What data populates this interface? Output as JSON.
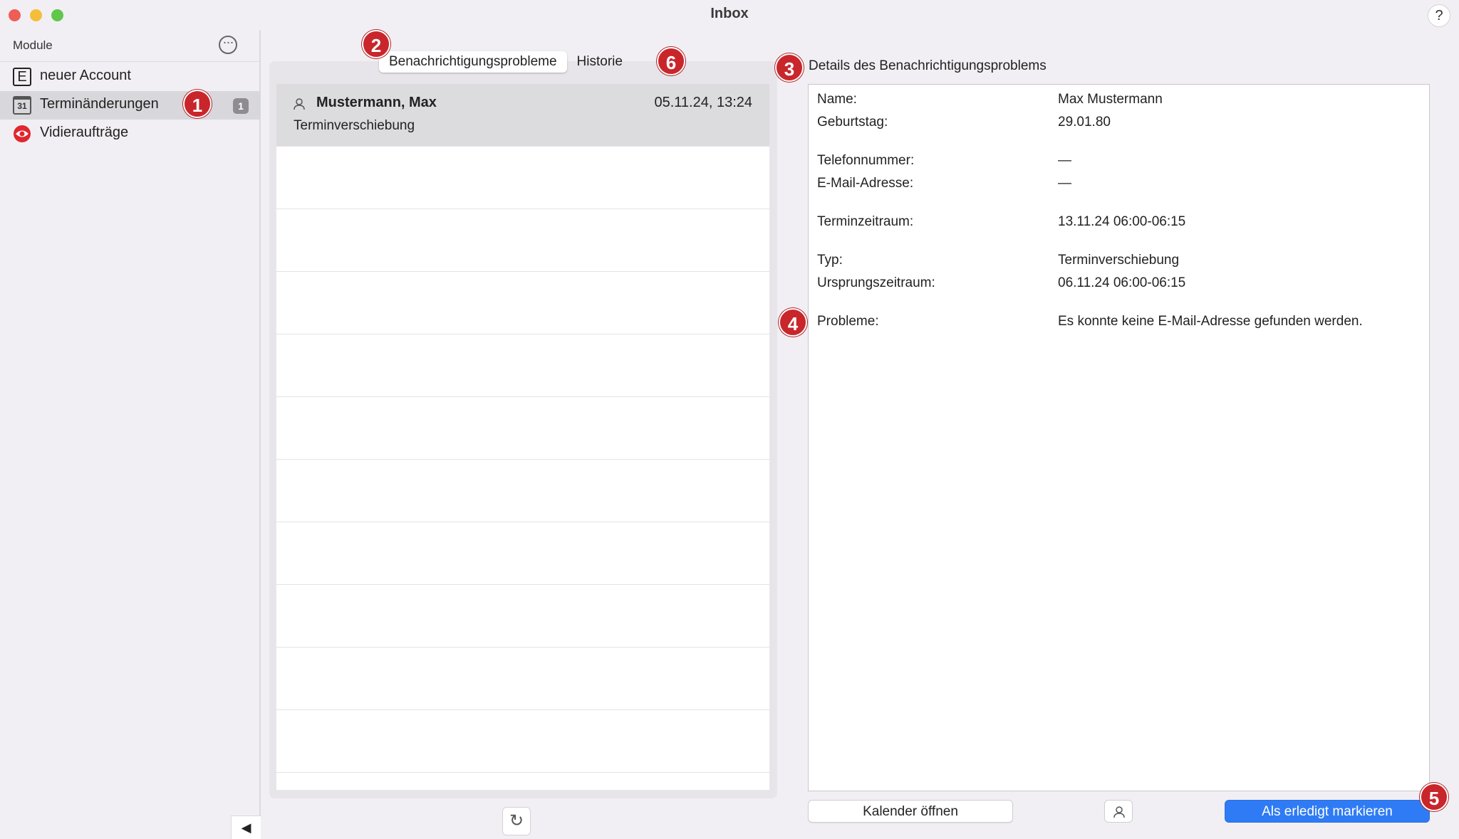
{
  "window": {
    "title": "Inbox",
    "help_label": "?"
  },
  "sidebar": {
    "header": "Module",
    "more_icon": "ellipsis-circle-icon",
    "items": [
      {
        "label": "neuer Account",
        "icon": "E",
        "icon_name": "e-letter-icon"
      },
      {
        "label": "Terminänderungen",
        "icon": "31",
        "icon_name": "calendar-icon",
        "badge": "1"
      },
      {
        "label": "Vidieraufträge",
        "icon_name": "eye-icon"
      }
    ],
    "collapse_glyph": "◀"
  },
  "tabs": [
    {
      "label": "Benachrichtigungsprobleme",
      "selected": true
    },
    {
      "label": "Historie",
      "selected": false
    }
  ],
  "list": {
    "rows": [
      {
        "name": "Mustermann, Max",
        "date": "05.11.24, 13:24",
        "type": "Terminverschiebung",
        "selected": true
      }
    ],
    "refresh_glyph": "↻"
  },
  "details": {
    "title": "Details des Benachrichtigungsproblems",
    "fields": [
      {
        "label": "Name:",
        "value": "Max Mustermann"
      },
      {
        "label": "Geburtstag:",
        "value": "29.01.80"
      },
      {
        "label": "Telefonnummer:",
        "value": "—"
      },
      {
        "label": "E-Mail-Adresse:",
        "value": "—"
      },
      {
        "label": "Terminzeitraum:",
        "value": "13.11.24 06:00-06:15"
      },
      {
        "label": "Typ:",
        "value": "Terminverschiebung"
      },
      {
        "label": "Ursprungszeitraum:",
        "value": "06.11.24 06:00-06:15"
      },
      {
        "label": "Probleme:",
        "value": "Es konnte keine E-Mail-Adresse gefunden werden."
      }
    ]
  },
  "actions": {
    "open_calendar": "Kalender öffnen",
    "mark_done": "Als erledigt markieren"
  },
  "markers": [
    "1",
    "2",
    "3",
    "4",
    "5",
    "6"
  ],
  "colors": {
    "accent": "#2f7bf5",
    "marker": "#c8262b",
    "badge": "#8e8c90",
    "eye_icon": "#e0262e"
  }
}
